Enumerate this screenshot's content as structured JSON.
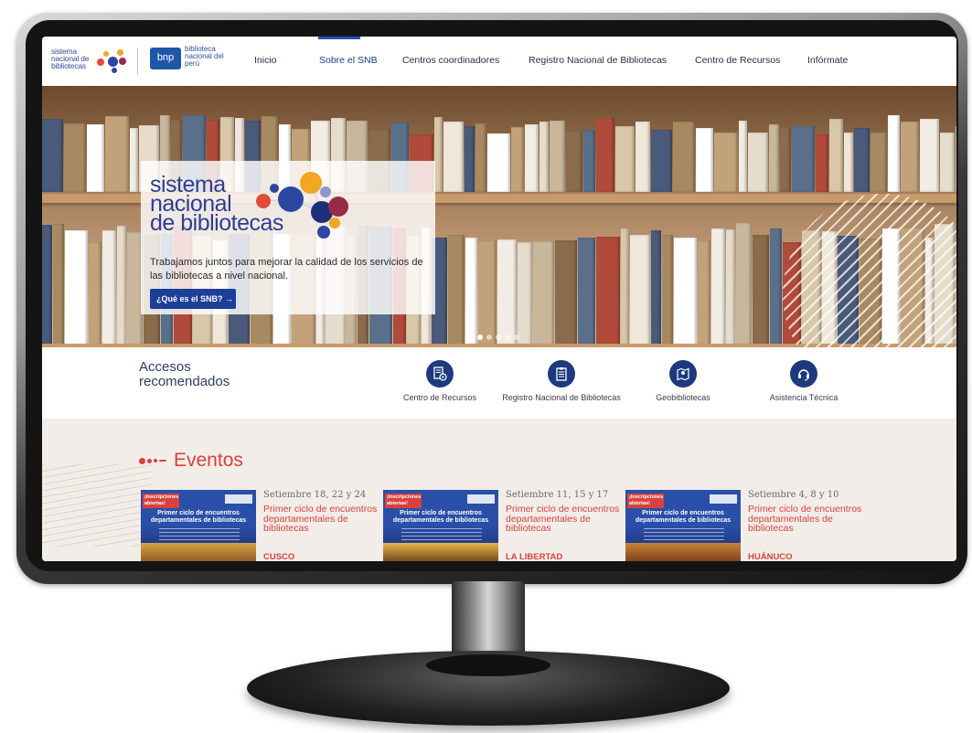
{
  "nav": {
    "logo_snb_text": "sistema nacional de bibliotecas",
    "logo_bnp_box": "bnp",
    "logo_bnp_text": "biblioteca nacional del perú",
    "items": [
      {
        "label": "Inicio"
      },
      {
        "label": "Sobre el SNB"
      },
      {
        "label": "Centros coordinadores"
      },
      {
        "label": "Registro Nacional de Bibliotecas"
      },
      {
        "label": "Centro de Recursos"
      },
      {
        "label": "Infórmate"
      }
    ],
    "active_index": 1
  },
  "hero": {
    "title_line1": "sistema",
    "title_line2": "nacional",
    "title_line3": "de bibliotecas",
    "subtitle": "Trabajamos juntos para mejorar la calidad de los servicios de las bibliotecas a nivel nacional.",
    "cta_label": "¿Qué es el SNB? →",
    "slides_count": 5,
    "active_slide": 0
  },
  "accesos": {
    "title": "Accesos recomendados",
    "items": [
      {
        "label": "Centro de Recursos",
        "icon": "document-play-icon"
      },
      {
        "label": "Registro Nacional de Bibliotecas",
        "icon": "clipboard-list-icon"
      },
      {
        "label": "Geobibliotecas",
        "icon": "map-pin-icon"
      },
      {
        "label": "Asistencia Técnica",
        "icon": "headset-icon"
      }
    ]
  },
  "eventos": {
    "title": "Eventos",
    "cards": [
      {
        "date": "Setiembre 18, 22 y 24",
        "desc": "Primer ciclo de encuentros departamentales de bibliotecas",
        "city": "CUSCO",
        "poster_badge": "¡Inscripciones abiertas!",
        "poster_title": "Primer ciclo de encuentros departamentales de bibliotecas"
      },
      {
        "date": "Setiembre 11, 15 y 17",
        "desc": "Primer ciclo de encuentros departamentales de bibliotecas",
        "city": "LA LIBERTAD",
        "poster_badge": "¡Inscripciones abiertas!",
        "poster_title": "Primer ciclo de encuentros departamentales de bibliotecas"
      },
      {
        "date": "Setiembre 4, 8 y 10",
        "desc": "Primer ciclo de encuentros departamentales de bibliotecas",
        "city": "HUÁNUCO",
        "poster_badge": "¡Inscripciones abiertas!",
        "poster_title": "Primer ciclo de encuentros departamentales de bibliotecas"
      }
    ]
  },
  "colors": {
    "brand_blue": "#1d3f9a",
    "accent_red": "#d8423c",
    "nav_text": "#2a2f45"
  }
}
